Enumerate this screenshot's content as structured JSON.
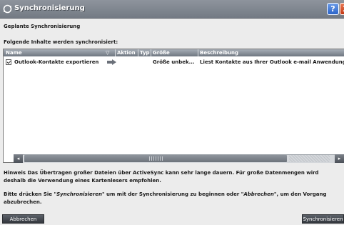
{
  "window": {
    "title": "Synchronisierung",
    "help_label": "?",
    "close_label": "X"
  },
  "labels": {
    "geplant": "Geplante Synchronisierung",
    "folgende": "Folgende Inhalte werden synchronisiert:"
  },
  "table": {
    "headers": [
      "Name",
      "Aktion",
      "Typ",
      "Größe",
      "Beschreibung"
    ],
    "rows": [
      {
        "checked": true,
        "name": "Outlook-Kontakte exportieren",
        "action_icon": "arrow-right-icon",
        "typ": "",
        "groesse": "Größe unbek...",
        "beschreibung": "Liest Kontakte aus Ihrer Outlook e-mail Anwendung un"
      }
    ]
  },
  "hinweis": "Hinweis Das Übertragen großer Dateien über ActiveSync kann sehr lange dauern. Für große Datenmengen wird deshalb die Verwendung eines Kartenlesers empfohlen.",
  "instruction": {
    "prefix": "Bitte drücken Sie ",
    "sync_word": "\"Synchronisieren\"",
    "middle": " um mit der Synchronisierung zu beginnen oder ",
    "cancel_word": "\"Abbrechen\"",
    "suffix": ", um den Vorgang abzubrechen."
  },
  "buttons": {
    "cancel": "Abbrechen",
    "sync": "Synchronisieren"
  },
  "colors": {
    "titlebar": "#7c838c",
    "window_bg": "#ececec",
    "close": "#c94a24",
    "help": "#3b6fd0"
  }
}
